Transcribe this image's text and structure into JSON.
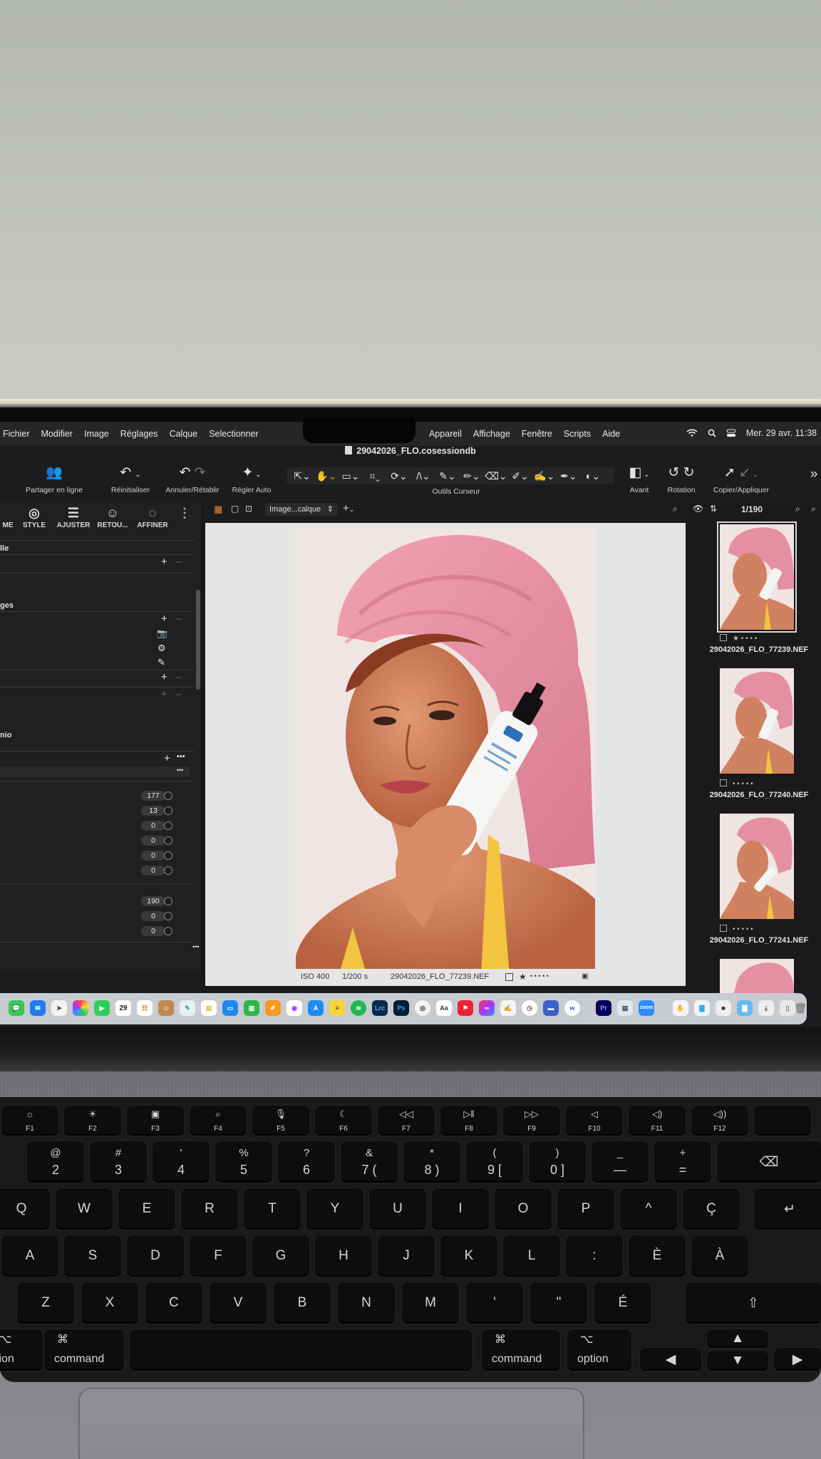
{
  "menubar": {
    "menus_left": [
      "Fichier",
      "Modifier",
      "Image",
      "Réglages",
      "Calque",
      "Selectionner"
    ],
    "menus_right": [
      "Appareil",
      "Affichage",
      "Fenêtre",
      "Scripts",
      "Aide"
    ],
    "datetime": "Mer. 29 avr. 11:38"
  },
  "window": {
    "title": "29042026_FLO.cosessiondb"
  },
  "toolbar": {
    "share_label": "Partager en ligne",
    "reset_label": "Réinitialiser",
    "undo_redo_label": "Annuler/Rétablir",
    "auto_label": "Régler Auto",
    "cursor_tools_label": "Outils Curseur",
    "before_label": "Avant",
    "rotation_label": "Rotation",
    "copy_apply_label": "Copier/Appliquer",
    "more_glyph": "»"
  },
  "left_panel": {
    "tabs": [
      {
        "label": "ME",
        "icon": "home-icon"
      },
      {
        "label": "STYLE",
        "icon": "style-icon"
      },
      {
        "label": "AJUSTER",
        "icon": "sliders-icon"
      },
      {
        "label": "RETOU...",
        "icon": "face-icon"
      },
      {
        "label": "AFFINER",
        "icon": "refine-icon"
      }
    ],
    "section1_label": "lle",
    "section2_label": "ges",
    "section3_label": "nio",
    "values_a": [
      "177",
      "13",
      "0",
      "0",
      "0",
      "0"
    ],
    "values_b": [
      "190",
      "0",
      "0"
    ],
    "more_glyph": "•••"
  },
  "viewer": {
    "layer_select": "Image...calque",
    "footer": {
      "iso": "ISO 400",
      "shutter": "1/200 s",
      "filename": "29042026_FLO_77239.NEF",
      "rating_star": "★",
      "rating_dots": "• • • • •"
    }
  },
  "browser": {
    "counter": "1/190",
    "items": [
      {
        "name": "29042026_FLO_77239.NEF",
        "selected": true,
        "rating": 1
      },
      {
        "name": "29042026_FLO_77240.NEF",
        "selected": false,
        "rating": 0
      },
      {
        "name": "29042026_FLO_77241.NEF",
        "selected": false,
        "rating": 0
      }
    ],
    "star": "★",
    "dots": "• • • •",
    "dots5": "• • • • •"
  },
  "dock": {
    "calendar_day": "29",
    "icons": [
      "Lrc",
      "Ps",
      "Pr",
      "zoom",
      "w"
    ]
  },
  "keyboard": {
    "fn_row": [
      "F1",
      "F2",
      "F3",
      "F4",
      "F5",
      "F6",
      "F7",
      "F8",
      "F9",
      "F10",
      "F11",
      "F12"
    ],
    "num_row": [
      {
        "top": "@",
        "bot": "2"
      },
      {
        "top": "#",
        "bot": "3"
      },
      {
        "top": "'",
        "bot": "4"
      },
      {
        "top": "%",
        "bot": "5"
      },
      {
        "top": "?",
        "bot": "6"
      },
      {
        "top": "&",
        "bot": "7 ("
      },
      {
        "top": "*",
        "bot": "8 )"
      },
      {
        "top": "(",
        "bot": "9 ["
      },
      {
        "top": ")",
        "bot": "0 ]"
      },
      {
        "top": "_",
        "bot": "—"
      },
      {
        "top": "+",
        "bot": "="
      }
    ],
    "row_q": [
      "Q",
      "W",
      "E",
      "R",
      "T",
      "Y",
      "U",
      "I",
      "O",
      "P",
      "^",
      "Ç"
    ],
    "row_a": [
      "A",
      "S",
      "D",
      "F",
      "G",
      "H",
      "J",
      "K",
      "L",
      ":",
      "È",
      "À"
    ],
    "row_z": [
      "Z",
      "X",
      "C",
      "V",
      "B",
      "N",
      "M",
      "'",
      "\"",
      "É"
    ],
    "mods": {
      "option_left": "tion",
      "command_left": "command",
      "command_right": "command",
      "option_right": "option",
      "cmd_glyph": "⌘",
      "opt_glyph": "⌥"
    }
  }
}
